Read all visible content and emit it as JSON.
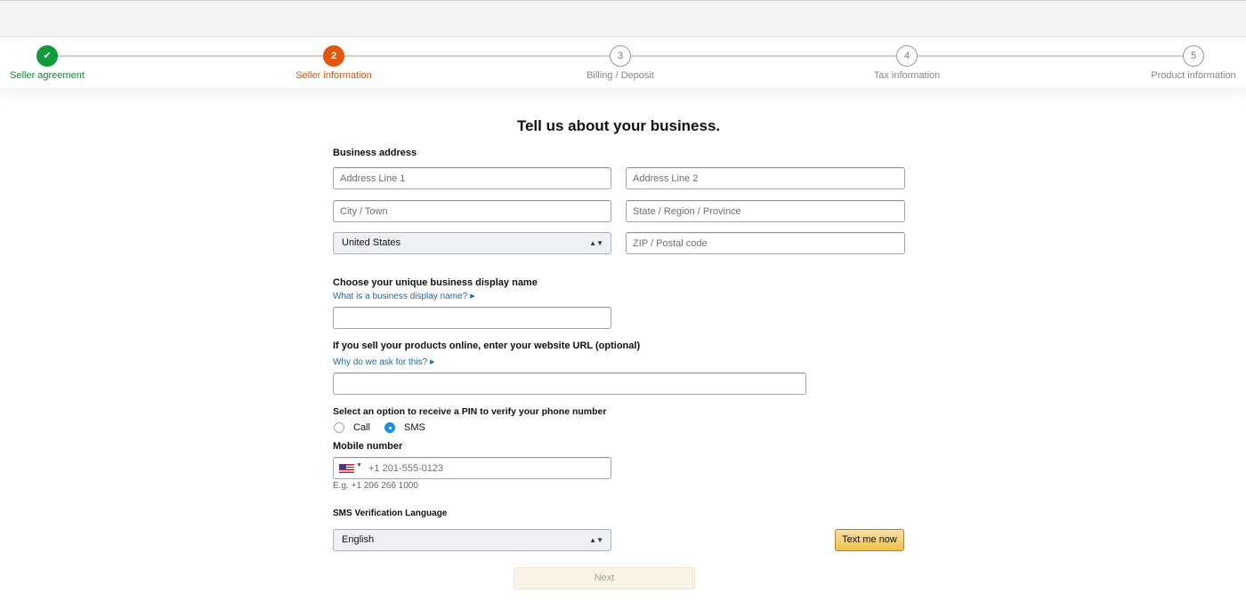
{
  "stepper": {
    "steps": [
      {
        "number": "✔",
        "label": "Seller agreement",
        "state": "done"
      },
      {
        "number": "2",
        "label": "Seller information",
        "state": "active"
      },
      {
        "number": "3",
        "label": "Billing / Deposit",
        "state": "pending"
      },
      {
        "number": "4",
        "label": "Tax information",
        "state": "pending"
      },
      {
        "number": "5",
        "label": "Product information",
        "state": "pending"
      }
    ]
  },
  "form": {
    "title": "Tell us about your business.",
    "business_address": {
      "label": "Business address",
      "address_line_1": {
        "placeholder": "Address Line 1",
        "value": ""
      },
      "address_line_2": {
        "placeholder": "Address Line 2",
        "value": ""
      },
      "city": {
        "placeholder": "City / Town",
        "value": ""
      },
      "state": {
        "placeholder": "State / Region / Province",
        "value": ""
      },
      "country": {
        "selected": "United States"
      },
      "zip": {
        "placeholder": "ZIP / Postal code",
        "value": ""
      }
    },
    "display_name": {
      "label": "Choose your unique business display name",
      "help_link": "What is a business display name?",
      "value": ""
    },
    "website": {
      "label": "If you sell your products online, enter your website URL (optional)",
      "help_link": "Why do we ask for this?",
      "value": ""
    },
    "pin_option": {
      "label": "Select an option to receive a PIN to verify your phone number",
      "options": [
        "Call",
        "SMS"
      ],
      "selected": "SMS"
    },
    "mobile": {
      "label": "Mobile number",
      "country_code_flag": "us-flag-icon",
      "placeholder": "+1 201-555-0123",
      "value": "",
      "hint": "E.g. +1 206 266 1000"
    },
    "sms_language": {
      "label": "SMS Verification Language",
      "selected": "English"
    },
    "text_me_now": "Text me now",
    "next": "Next"
  },
  "colors": {
    "done": "#0f9b3a",
    "active": "#e2570b",
    "link": "#1a6aa6",
    "primary_button": "#f0c14b"
  }
}
